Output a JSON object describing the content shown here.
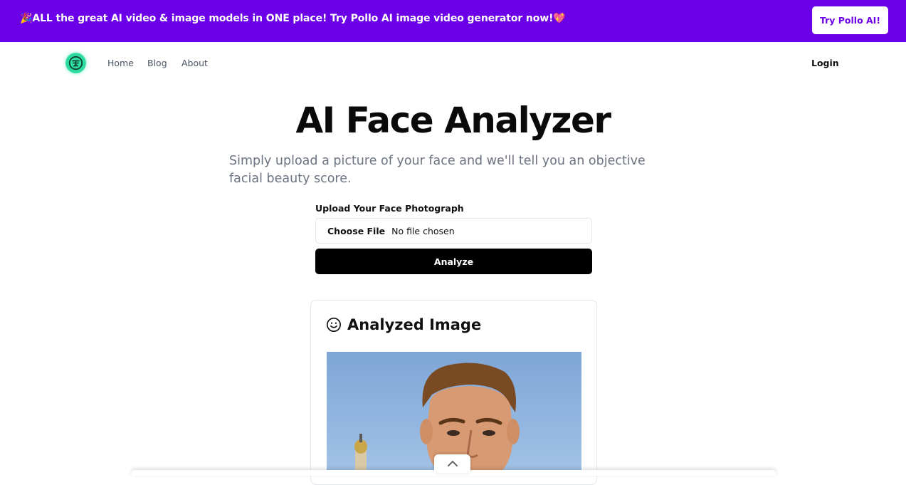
{
  "promo": {
    "text": "🎉ALL the great AI video & image models in ONE place! Try Pollo AI image video generator now!💖",
    "button_label": "Try Pollo AI!"
  },
  "nav": {
    "logo_icon": "sparkle-logo-icon",
    "links": [
      "Home",
      "Blog",
      "About"
    ],
    "login_label": "Login"
  },
  "hero": {
    "title": "AI Face Analyzer",
    "subtitle": "Simply upload a picture of your face and we'll tell you an objective facial beauty score."
  },
  "upload": {
    "label": "Upload Your Face Photograph",
    "choose_file_label": "Choose File",
    "file_status": "No file chosen",
    "analyze_label": "Analyze"
  },
  "result_card": {
    "icon": "smile-icon",
    "title": "Analyzed Image"
  },
  "controls": {
    "scroll_up_icon": "chevron-up-icon"
  },
  "colors": {
    "brand_purple": "#6b00e8",
    "logo_green": "#2ad99e",
    "button_black": "#000000"
  }
}
